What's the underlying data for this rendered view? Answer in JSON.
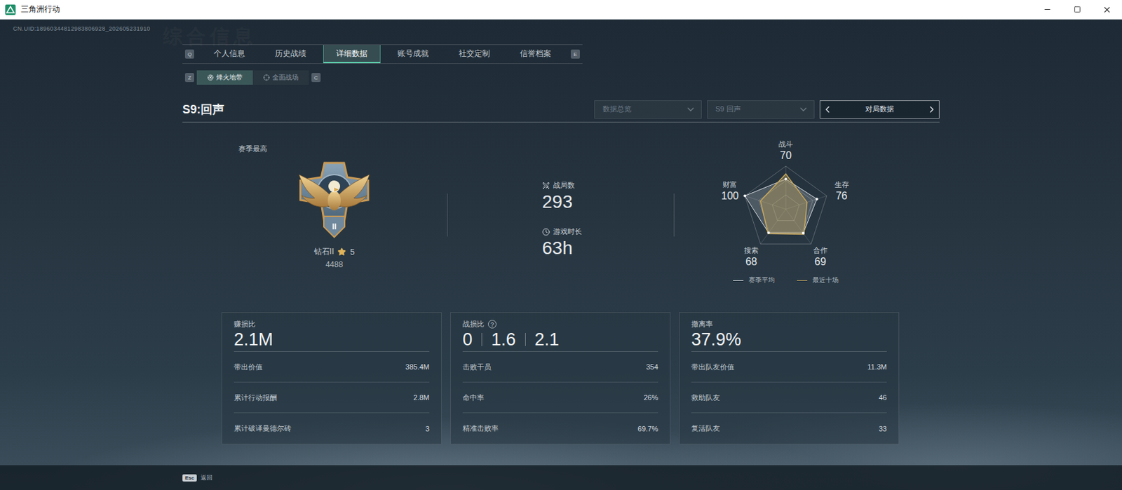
{
  "window": {
    "title": "三角洲行动"
  },
  "uid": "CN.UID:18960344812983806928_202605231910",
  "watermark": "综合信息",
  "tabs": {
    "prev_key": "Q",
    "next_key": "E",
    "items": [
      {
        "label": "个人信息",
        "selected": false
      },
      {
        "label": "历史战绩",
        "selected": false
      },
      {
        "label": "详细数据",
        "selected": true
      },
      {
        "label": "账号成就",
        "selected": false
      },
      {
        "label": "社交定制",
        "selected": false
      },
      {
        "label": "信誉档案",
        "selected": false
      }
    ]
  },
  "subtabs": {
    "prev_key": "Z",
    "next_key": "C",
    "items": [
      {
        "label": "烽火地带",
        "selected": true
      },
      {
        "label": "全面战场",
        "selected": false
      }
    ]
  },
  "header": {
    "title": "S9:回声",
    "filters": [
      {
        "label": "数据总览",
        "disabled": true
      },
      {
        "label": "S9 回声",
        "disabled": true
      }
    ],
    "stepper": {
      "label": "对局数据"
    }
  },
  "rank": {
    "caption": "赛季最高",
    "badge_numeral": "II",
    "tier": "钻石II",
    "star_count": "5",
    "points": "4488"
  },
  "stats": [
    {
      "label": "战局数",
      "value": "293"
    },
    {
      "label": "游戏时长",
      "value": "63h"
    }
  ],
  "radar": {
    "max": 100,
    "axes": [
      {
        "label": "战斗",
        "value": "70"
      },
      {
        "label": "生存",
        "value": "76"
      },
      {
        "label": "合作",
        "value": "69"
      },
      {
        "label": "搜索",
        "value": "68"
      },
      {
        "label": "财富",
        "value": "100"
      }
    ],
    "series": [
      {
        "name": "赛季平均",
        "values": [
          70,
          76,
          69,
          68,
          100
        ],
        "color": "#d9dee3"
      },
      {
        "name": "最近十场",
        "values": [
          82,
          52,
          72,
          70,
          62
        ],
        "color": "#c9a85c"
      }
    ]
  },
  "cards": [
    {
      "title": "赚损比",
      "kind": "single",
      "value": "2.1M",
      "rows": [
        {
          "label": "带出价值",
          "value": "385.4M"
        },
        {
          "label": "累计行动报酬",
          "value": "2.8M"
        },
        {
          "label": "累计破译曼德尔砖",
          "value": "3"
        }
      ]
    },
    {
      "title": "战损比",
      "help": "?",
      "kind": "triple",
      "values": [
        "0",
        "1.6",
        "2.1"
      ],
      "rows": [
        {
          "label": "击败干员",
          "value": "354"
        },
        {
          "label": "命中率",
          "value": "26%"
        },
        {
          "label": "精准击败率",
          "value": "69.7%"
        }
      ]
    },
    {
      "title": "撤离率",
      "kind": "single",
      "value": "37.9%",
      "rows": [
        {
          "label": "带出队友价值",
          "value": "11.3M"
        },
        {
          "label": "救助队友",
          "value": "46"
        },
        {
          "label": "复活队友",
          "value": "33"
        }
      ]
    }
  ],
  "footer": {
    "key": "Esc",
    "label": "返回"
  }
}
